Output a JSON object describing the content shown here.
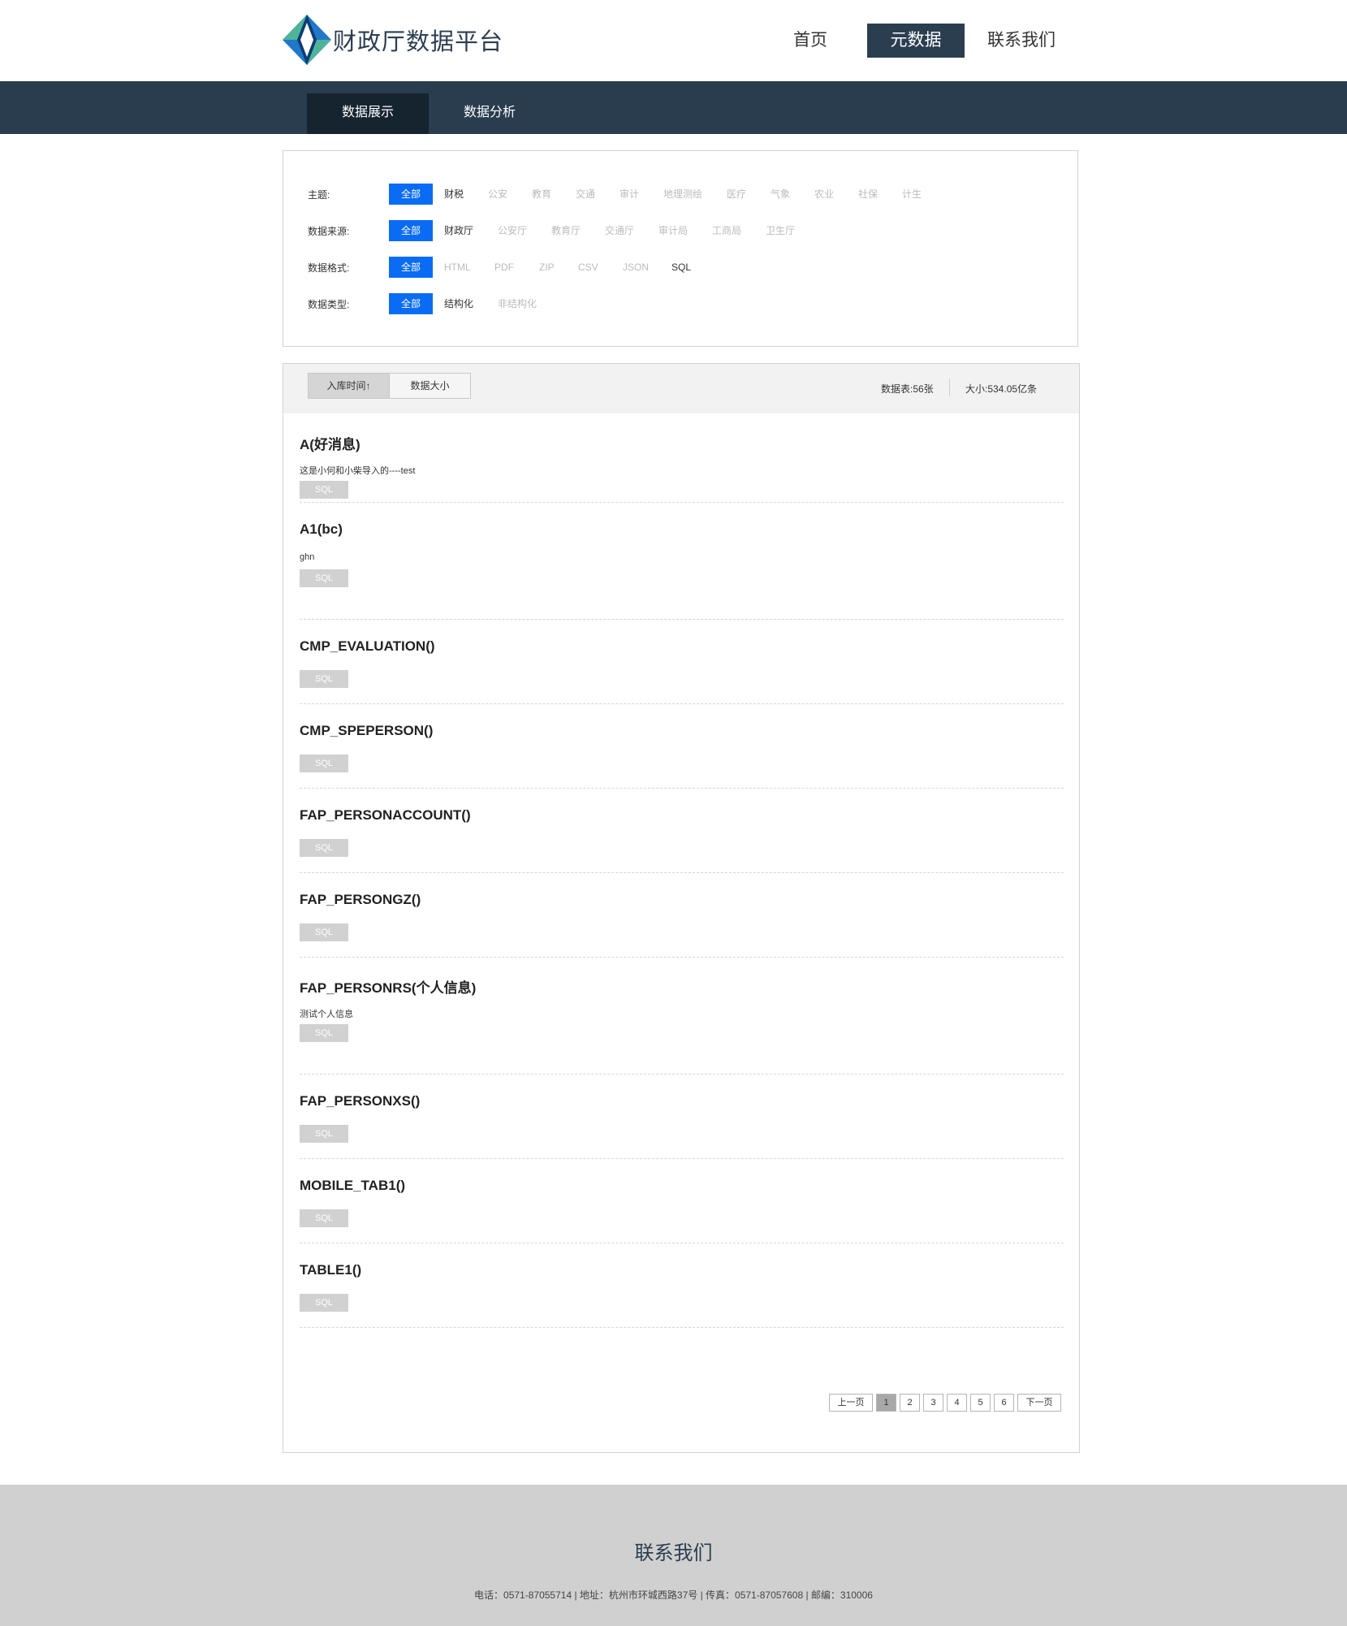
{
  "header": {
    "site_title": "财政厅数据平台",
    "nav": [
      "首页",
      "元数据",
      "联系我们"
    ],
    "active_nav": 1,
    "brand_colors": {
      "blue": "#1f78c8",
      "teal": "#4fb39a",
      "dark": "#2b3e50"
    }
  },
  "subnav": {
    "items": [
      "数据展示",
      "数据分析"
    ],
    "active": 0
  },
  "filters": {
    "topic": {
      "label": "主题:",
      "options": [
        "全部",
        "财税",
        "公安",
        "教育",
        "交通",
        "审计",
        "地理测绘",
        "医疗",
        "气象",
        "农业",
        "社保",
        "计生"
      ]
    },
    "source": {
      "label": "数据来源:",
      "options": [
        "全部",
        "财政厅",
        "公安厅",
        "教育厅",
        "交通厅",
        "审计局",
        "工商局",
        "卫生厅"
      ]
    },
    "format": {
      "label": "数据格式:",
      "options": [
        "全部",
        "HTML",
        "PDF",
        "ZIP",
        "CSV",
        "JSON",
        "SQL"
      ]
    },
    "type": {
      "label": "数据类型:",
      "options": [
        "全部",
        "结构化",
        "非结构化"
      ]
    },
    "selected_color": "#0a6cf5"
  },
  "list": {
    "sort": [
      "入库时间↑",
      "数据大小"
    ],
    "active_sort": 0,
    "stats": {
      "tables": "数据表:56张",
      "size": "大小:534.05亿条"
    },
    "items": [
      {
        "title": "A(好消息)",
        "desc": "这是小何和小柴导入的----test",
        "tag": "SQL"
      },
      {
        "title": "A1(bc)",
        "desc": "ghn",
        "tag": "SQL"
      },
      {
        "title": "CMP_EVALUATION()",
        "desc": "",
        "tag": "SQL"
      },
      {
        "title": "CMP_SPEPERSON()",
        "desc": "",
        "tag": "SQL"
      },
      {
        "title": "FAP_PERSONACCOUNT()",
        "desc": "",
        "tag": "SQL"
      },
      {
        "title": "FAP_PERSONGZ()",
        "desc": "",
        "tag": "SQL"
      },
      {
        "title": "FAP_PERSONRS(个人信息)",
        "desc": "测试个人信息",
        "tag": "SQL"
      },
      {
        "title": "FAP_PERSONXS()",
        "desc": "",
        "tag": "SQL"
      },
      {
        "title": "MOBILE_TAB1()",
        "desc": "",
        "tag": "SQL"
      },
      {
        "title": "TABLE1()",
        "desc": "",
        "tag": "SQL"
      }
    ],
    "pager": {
      "prev": "上一页",
      "pages": [
        "1",
        "2",
        "3",
        "4",
        "5",
        "6"
      ],
      "current_page": "1",
      "next": "下一页"
    }
  },
  "footer": {
    "title": "联系我们",
    "info": "电话：0571-87055714 | 地址：杭州市环城西路37号 | 传真：0571-87057608 | 邮编：310006"
  }
}
